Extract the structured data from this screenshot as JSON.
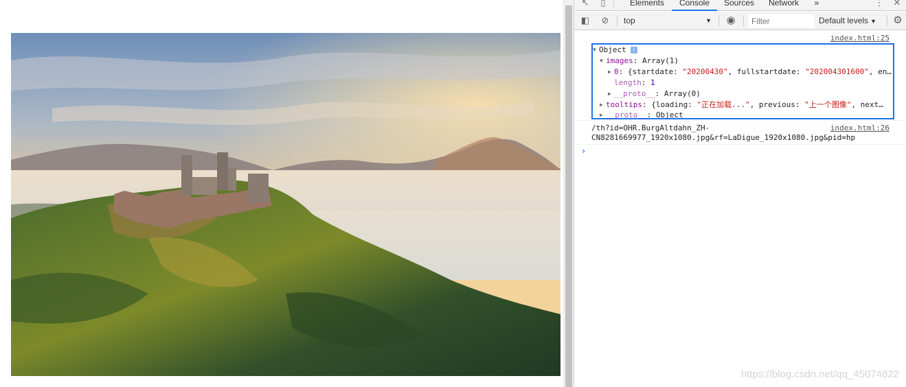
{
  "devtools": {
    "tabs": [
      {
        "label": "Elements",
        "active": false
      },
      {
        "label": "Console",
        "active": true
      },
      {
        "label": "Sources",
        "active": false
      },
      {
        "label": "Network",
        "active": false
      }
    ],
    "more_tabs_label": "»",
    "toolbar": {
      "context": "top",
      "filter_placeholder": "Filter",
      "levels_label": "Default levels"
    }
  },
  "console": {
    "messages": [
      {
        "source": "index.html:25",
        "root_label": "Object",
        "lines": {
          "images_key": "images",
          "images_val": "Array(1)",
          "item0_key": "0",
          "item0_pre": "{startdate: ",
          "item0_str1": "\"20200430\"",
          "item0_mid": ", fullstartdate: ",
          "item0_str2": "\"202004301600\"",
          "item0_post": ", en…",
          "length_key": "length",
          "length_val": "1",
          "proto_inner_key": "__proto__",
          "proto_inner_val": "Array(0)",
          "tooltips_key": "tooltips",
          "tooltips_pre": "{loading: ",
          "tooltips_str1": "\"正在加载...\"",
          "tooltips_mid": ", previous: ",
          "tooltips_str2": "\"上一个图像\"",
          "tooltips_post": ", next…",
          "proto_outer_key": "__proto__",
          "proto_outer_val": "Object"
        }
      },
      {
        "source": "index.html:26",
        "text_line1": "/th?id=OHR.BurgAltdahn_ZH-",
        "text_line2": "CN8281669977_1920x1080.jpg&rf=LaDigue_1920x1080.jpg&pid=hp"
      }
    ],
    "prompt_symbol": "›"
  },
  "watermark": "https://blog.csdn.net/qq_45074822",
  "colors": {
    "accent": "#1a73e8",
    "key": "#881391",
    "string": "#c41a16",
    "number": "#1c00cf"
  }
}
